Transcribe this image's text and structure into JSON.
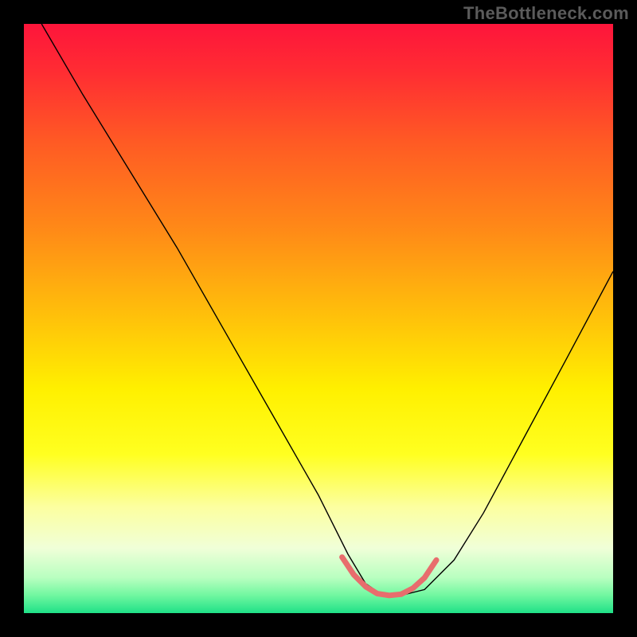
{
  "watermark": "TheBottleneck.com",
  "chart_data": {
    "type": "line",
    "title": "",
    "xlabel": "",
    "ylabel": "",
    "xlim": [
      0,
      100
    ],
    "ylim": [
      0,
      100
    ],
    "legend": false,
    "background_gradient": {
      "stops": [
        {
          "offset": 0.0,
          "color": "#fe153b"
        },
        {
          "offset": 0.08,
          "color": "#ff2c33"
        },
        {
          "offset": 0.2,
          "color": "#ff5a24"
        },
        {
          "offset": 0.35,
          "color": "#ff8a17"
        },
        {
          "offset": 0.5,
          "color": "#ffc20a"
        },
        {
          "offset": 0.62,
          "color": "#fff000"
        },
        {
          "offset": 0.73,
          "color": "#ffff20"
        },
        {
          "offset": 0.82,
          "color": "#fcffa0"
        },
        {
          "offset": 0.89,
          "color": "#f0ffd8"
        },
        {
          "offset": 0.94,
          "color": "#b8ffc0"
        },
        {
          "offset": 0.97,
          "color": "#70f7a0"
        },
        {
          "offset": 1.0,
          "color": "#1fe087"
        }
      ]
    },
    "series": [
      {
        "name": "bottleneck-curve",
        "color": "#000000",
        "stroke_width": 1.4,
        "x": [
          3,
          10,
          18,
          26,
          34,
          42,
          50,
          55,
          58,
          61,
          64,
          68,
          73,
          78,
          85,
          92,
          100
        ],
        "y": [
          100,
          88,
          75,
          62,
          48,
          34,
          20,
          10,
          5,
          3,
          3,
          4,
          9,
          17,
          30,
          43,
          58
        ]
      },
      {
        "name": "optimal-range-highlight",
        "color": "#e86d6d",
        "stroke_width": 7,
        "linecap": "round",
        "x": [
          54,
          56,
          58,
          60,
          62,
          64,
          66,
          68,
          70
        ],
        "y": [
          9.5,
          6.5,
          4.5,
          3.3,
          3.0,
          3.2,
          4.2,
          6.0,
          9.0
        ]
      }
    ],
    "annotations": []
  }
}
